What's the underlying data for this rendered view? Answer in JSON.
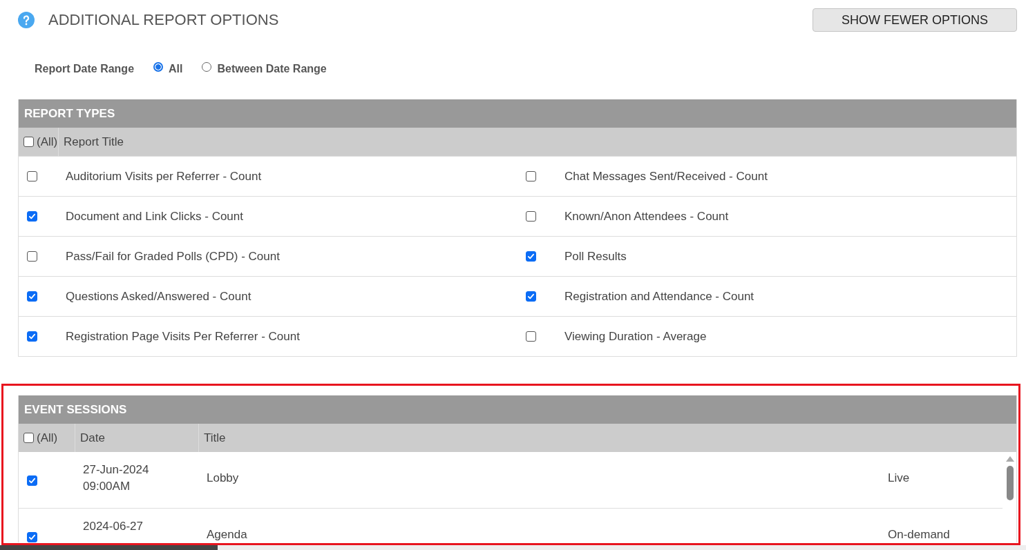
{
  "header": {
    "title": "ADDITIONAL REPORT OPTIONS",
    "button": "SHOW FEWER OPTIONS"
  },
  "date_range": {
    "label": "Report Date Range",
    "options": [
      {
        "label": "All",
        "selected": true
      },
      {
        "label": "Between Date Range",
        "selected": false
      }
    ]
  },
  "report_types": {
    "title": "REPORT TYPES",
    "select_all": {
      "label": "(All)",
      "checked": false
    },
    "column": "Report Title",
    "items": [
      {
        "label": "Auditorium Visits per Referrer - Count",
        "checked": false
      },
      {
        "label": "Chat Messages Sent/Received - Count",
        "checked": false
      },
      {
        "label": "Document and Link Clicks - Count",
        "checked": true
      },
      {
        "label": "Known/Anon Attendees - Count",
        "checked": false
      },
      {
        "label": "Pass/Fail for Graded Polls (CPD) - Count",
        "checked": false
      },
      {
        "label": "Poll Results",
        "checked": true
      },
      {
        "label": "Questions Asked/Answered - Count",
        "checked": true
      },
      {
        "label": "Registration and Attendance - Count",
        "checked": true
      },
      {
        "label": "Registration Page Visits Per Referrer - Count",
        "checked": true
      },
      {
        "label": "Viewing Duration - Average",
        "checked": false
      }
    ]
  },
  "event_sessions": {
    "title": "EVENT SESSIONS",
    "select_all": {
      "label": "(All)",
      "checked": false
    },
    "columns": [
      "Date",
      "Title"
    ],
    "rows": [
      {
        "checked": true,
        "date": [
          "27-Jun-2024",
          "09:00AM"
        ],
        "title": "Lobby",
        "type": "Live"
      },
      {
        "checked": true,
        "date": [
          "2024-06-27"
        ],
        "title": "Agenda",
        "type": "On-demand"
      }
    ]
  }
}
